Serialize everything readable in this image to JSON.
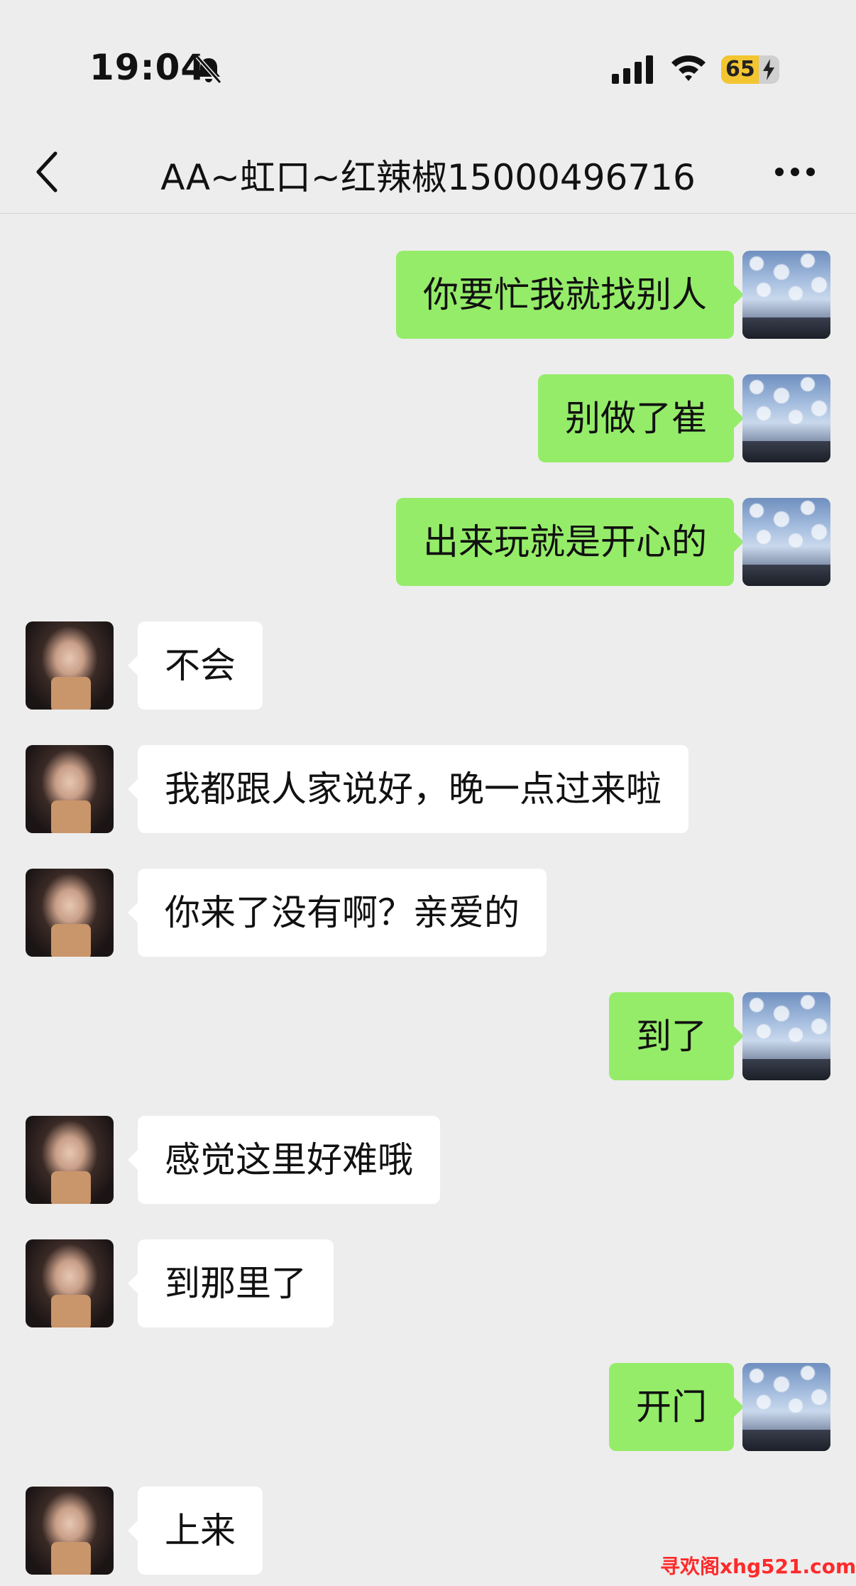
{
  "status_bar": {
    "time": "19:04",
    "battery_level": "65",
    "battery_fraction": 0.65,
    "icons": [
      "bell-slash-icon",
      "cellular-signal-icon",
      "wifi-icon",
      "charging-bolt-icon"
    ]
  },
  "header": {
    "title": "AA~虹口~红辣椒15000496716",
    "back_icon": "chevron-left-icon",
    "more_icon": "ellipsis-icon"
  },
  "messages": [
    {
      "sender": "me",
      "text": "你要忙我就找别人"
    },
    {
      "sender": "me",
      "text": "别做了崔"
    },
    {
      "sender": "me",
      "text": "出来玩就是开心的"
    },
    {
      "sender": "her",
      "text": "不会"
    },
    {
      "sender": "her",
      "text": "我都跟人家说好，晚一点过来啦"
    },
    {
      "sender": "her",
      "text": "你来了没有啊？亲爱的"
    },
    {
      "sender": "me",
      "text": "到了"
    },
    {
      "sender": "her",
      "text": "感觉这里好难哦"
    },
    {
      "sender": "her",
      "text": "到那里了"
    },
    {
      "sender": "me",
      "text": "开门"
    },
    {
      "sender": "her",
      "text": "上来"
    }
  ],
  "watermark": "寻欢阁xhg521.com",
  "colors": {
    "background": "#ededed",
    "my_bubble": "#95ec69",
    "her_bubble": "#ffffff",
    "battery": "#f3c530",
    "watermark": "#ff2a2a"
  }
}
